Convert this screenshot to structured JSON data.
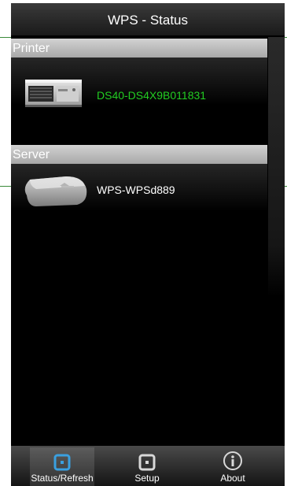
{
  "header": {
    "title": "WPS - Status"
  },
  "sections": {
    "printer": {
      "heading": "Printer",
      "device_name": "DS40-DS4X9B011831",
      "name_color": "#22cc22"
    },
    "server": {
      "heading": "Server",
      "device_name": "WPS-WPSd889",
      "name_color": "#ffffff"
    }
  },
  "tabs": [
    {
      "label": "Status/Refresh",
      "icon": "status-refresh-icon",
      "active": true
    },
    {
      "label": "Setup",
      "icon": "setup-icon",
      "active": false
    },
    {
      "label": "About",
      "icon": "info-icon",
      "active": false
    }
  ],
  "colors": {
    "active_icon": "#3aa0e0",
    "guide_line": "#3a8a3a"
  }
}
